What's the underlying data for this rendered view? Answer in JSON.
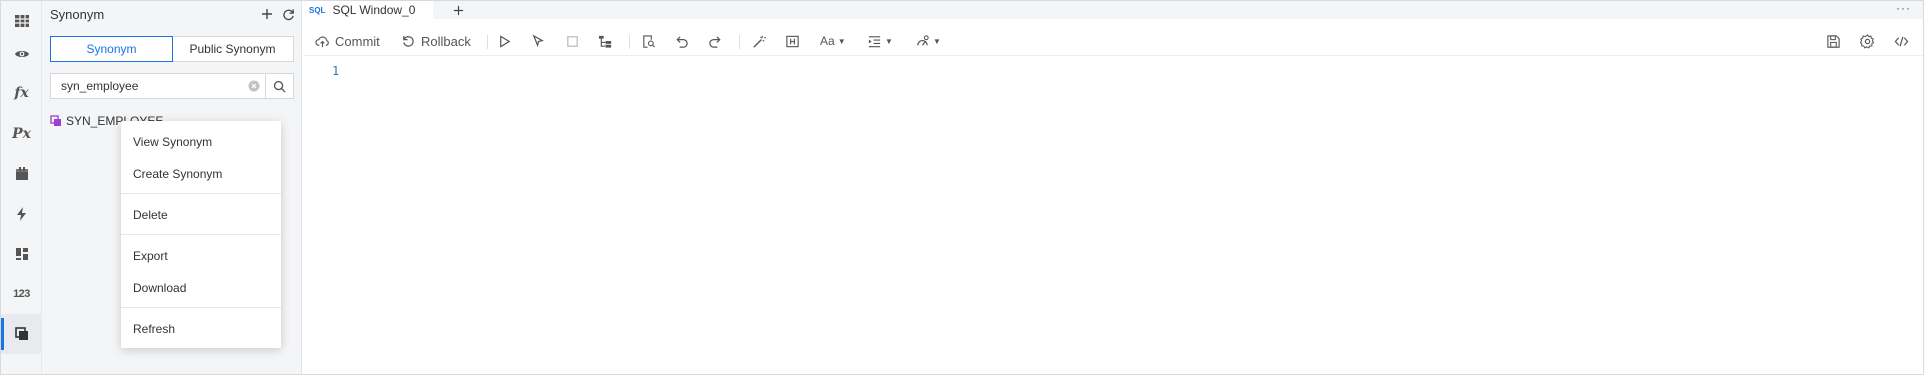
{
  "rail": {
    "items": [
      {
        "icon": "table-icon"
      },
      {
        "icon": "view-icon"
      },
      {
        "icon": "function-icon",
        "glyph": "fx"
      },
      {
        "icon": "procedure-icon",
        "glyph": "Px"
      },
      {
        "icon": "package-icon"
      },
      {
        "icon": "trigger-icon"
      },
      {
        "icon": "type-icon"
      },
      {
        "icon": "sequence-icon",
        "glyph": "123"
      },
      {
        "icon": "synonym-icon",
        "active": true
      }
    ]
  },
  "panel": {
    "title": "Synonym",
    "tabs": [
      "Synonym",
      "Public Synonym"
    ],
    "active_tab": "Synonym",
    "search_value": "syn_employee",
    "tree_items": [
      "SYN_EMPLOYEE"
    ]
  },
  "context_menu": {
    "items": [
      "View Synonym",
      "Create Synonym",
      "Delete",
      "Export",
      "Download",
      "Refresh"
    ]
  },
  "editor": {
    "tab_label": "SQL Window_0",
    "tab_badge": "SQL",
    "more_label": "···",
    "toolbar": {
      "commit_label": "Commit",
      "rollback_label": "Rollback",
      "format_label": "Aa"
    },
    "line_numbers": [
      "1"
    ]
  },
  "colors": {
    "accent": "#1a73e8",
    "synonym_icon": "#9b3fd8"
  }
}
